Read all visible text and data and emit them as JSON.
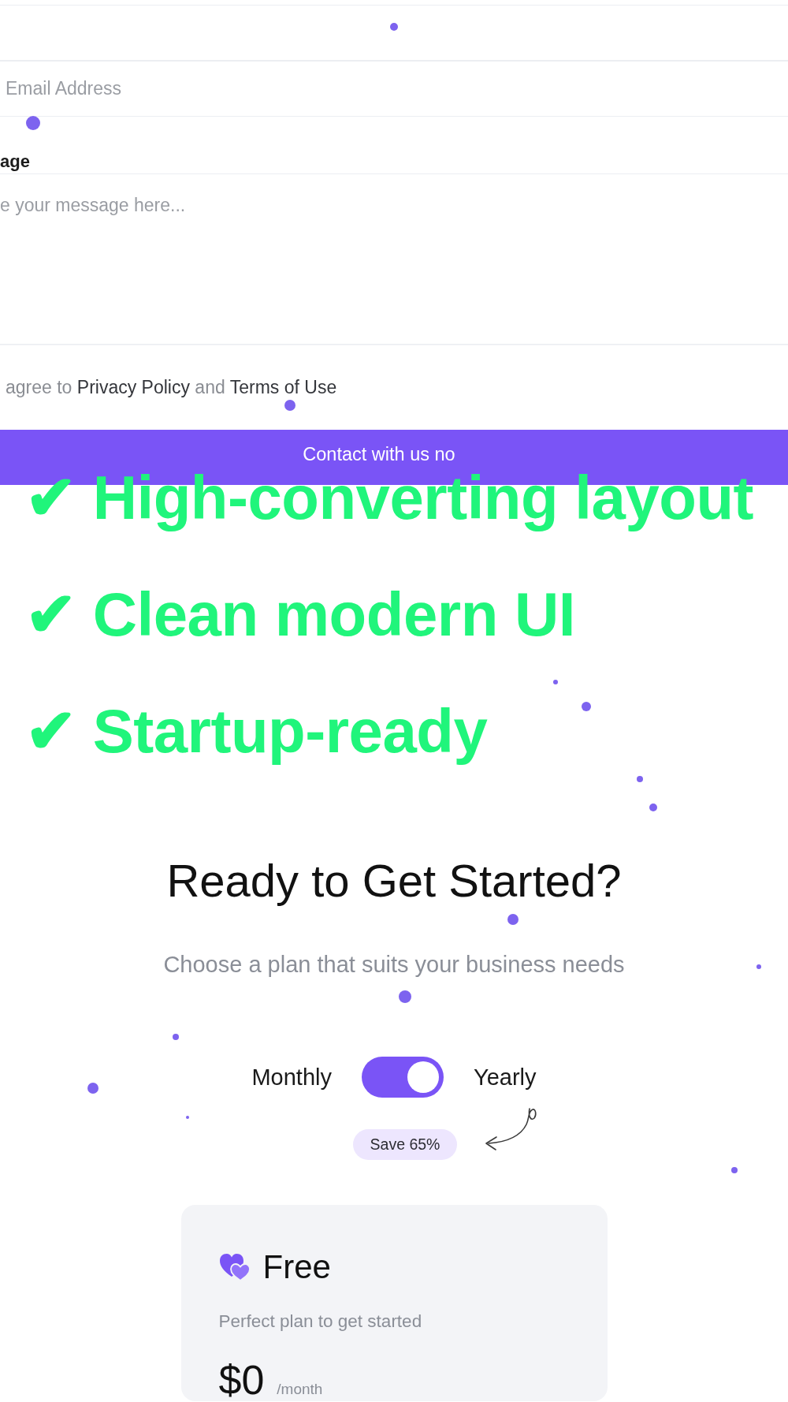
{
  "contact_form": {
    "fields": [
      {
        "kind": "input"
      },
      {
        "kind": "input",
        "placeholder": "Email Address"
      },
      {
        "kind": "label",
        "text": "age"
      },
      {
        "kind": "textarea",
        "placeholder": "e your message here..."
      }
    ],
    "agreement": [
      {
        "kind": "text",
        "text": "agree to"
      },
      {
        "kind": "link",
        "text": "Privacy Policy"
      },
      {
        "kind": "text",
        "text": "and"
      },
      {
        "kind": "link",
        "text": "Terms of Use"
      }
    ],
    "submit_button": "Contact with us no"
  },
  "captions": [
    "✔ High-converting layout",
    "✔ Clean modern UI",
    "✔ Startup-ready"
  ],
  "pricing": {
    "title": "Ready to Get Started?",
    "subtitle": "Choose a plan that suits your business needs",
    "billing_toggle": {
      "left_label": "Monthly",
      "right_label": "Yearly",
      "on": true
    },
    "save_badge": "Save 65%",
    "plans": [
      {
        "name": "Free",
        "description": "Perfect plan to get started",
        "price": "$0",
        "period": "/month"
      }
    ]
  }
}
